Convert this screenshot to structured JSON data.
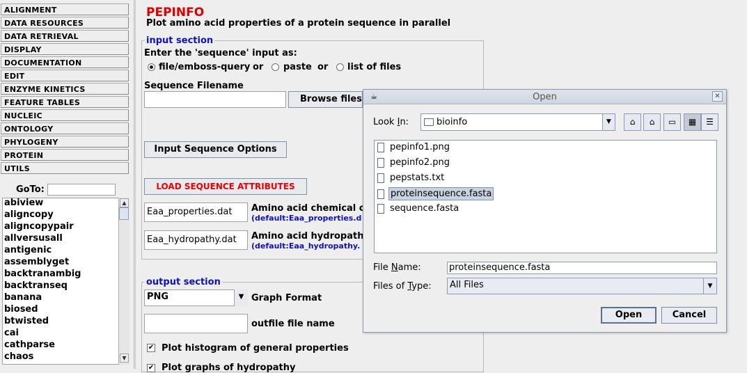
{
  "menu": {
    "categories": [
      "ALIGNMENT",
      "DATA RESOURCES",
      "DATA RETRIEVAL",
      "DISPLAY",
      "DOCUMENTATION",
      "EDIT",
      "ENZYME KINETICS",
      "FEATURE TABLES",
      "NUCLEIC",
      "ONTOLOGY",
      "PHYLOGENY",
      "PROTEIN",
      "UTILS"
    ],
    "goto_label": "GoTo:",
    "goto_value": "",
    "programs": [
      "abiview",
      "aligncopy",
      "aligncopypair",
      "allversusall",
      "antigenic",
      "assemblyget",
      "backtranambig",
      "backtranseq",
      "banana",
      "biosed",
      "btwisted",
      "cai",
      "cathparse",
      "chaos"
    ]
  },
  "app": {
    "title": "PEPINFO",
    "description": "Plot amino acid properties of a protein sequence in parallel"
  },
  "input_section": {
    "title": "input section",
    "prompt": "Enter the 'sequence' input as:",
    "options": [
      "file/emboss-query",
      "paste",
      "list of files"
    ],
    "or_label": "or",
    "selected_option": "file/emboss-query",
    "filename_label": "Sequence Filename",
    "filename_value": "",
    "browse_label": "Browse files...",
    "options_button": "Input Sequence Options",
    "load_button": "LOAD SEQUENCE ATTRIBUTES",
    "chem_value": "Eaa_properties.dat",
    "chem_label": "Amino acid chemical cla",
    "chem_default": "(default:Eaa_properties.d",
    "hydro_value": "Eaa_hydropathy.dat",
    "hydro_label": "Amino acid hydropathy",
    "hydro_default": "(default:Eaa_hydropathy."
  },
  "output_section": {
    "title": "output section",
    "graph_format_value": "PNG",
    "graph_format_label": "Graph Format",
    "outfile_value": "",
    "outfile_label": "outfile file name",
    "check1_label": "Plot histogram of general properties",
    "check1_checked": true,
    "check2_label": "Plot graphs of hydropathy",
    "check2_checked": true
  },
  "dialog": {
    "title": "Open",
    "look_in_label_pre": "Look ",
    "look_in_label_key": "I",
    "look_in_label_post": "n:",
    "look_in_value": "bioinfo",
    "files": [
      "pepinfo1.png",
      "pepinfo2.png",
      "pepstats.txt",
      "proteinsequence.fasta",
      "sequence.fasta"
    ],
    "selected_file": "proteinsequence.fasta",
    "file_name_label_pre": "File ",
    "file_name_label_key": "N",
    "file_name_label_post": "ame:",
    "file_name_value": "proteinsequence.fasta",
    "file_type_label_pre": "Files of ",
    "file_type_label_key": "T",
    "file_type_label_post": "ype:",
    "file_type_value": "All Files",
    "open_button": "Open",
    "cancel_button": "Cancel"
  }
}
